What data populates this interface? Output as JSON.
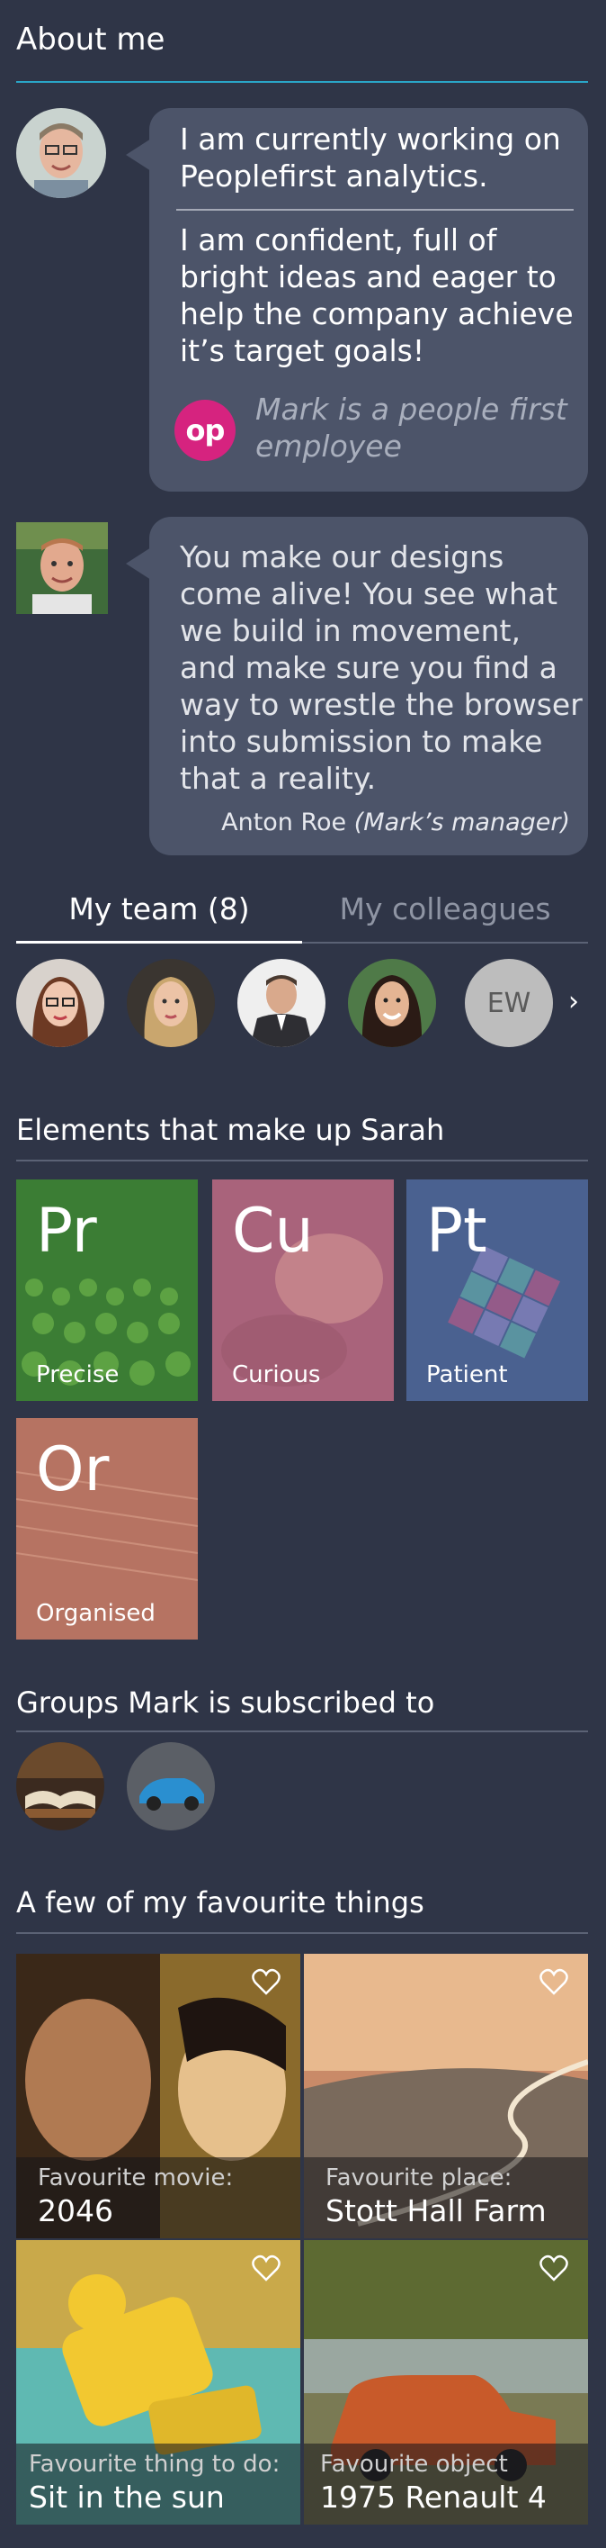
{
  "about": {
    "title": "About me",
    "bubble1": {
      "line1a": "I am currently working on",
      "line1b": "Peoplefirst analytics.",
      "line2a": "I am confident, full of",
      "line2b": "bright ideas and eager to",
      "line2c": "help the company achieve",
      "line2d": "it’s target goals!",
      "logo_text": "op",
      "note_a": "Mark is a people first",
      "note_b": "employee"
    },
    "bubble2": {
      "l1": "You make our designs",
      "l2": "come alive! You see what",
      "l3": "we build in movement,",
      "l4": "and make sure you find a",
      "l5": "way to wrestle the browser",
      "l6": "into submission to make",
      "l7": "that a reality.",
      "author": "Anton Roe ",
      "author_role": "(Mark’s manager)"
    }
  },
  "tabs": {
    "team": "My team (8)",
    "colleagues": "My colleagues",
    "active": "team",
    "initials_avatar": "EW"
  },
  "elements": {
    "title": "Elements that make up Sarah",
    "tiles": [
      {
        "symbol": "Pr",
        "word": "Precise",
        "color": "#3f8a3a"
      },
      {
        "symbol": "Cu",
        "word": "Curious",
        "color": "#b2627f"
      },
      {
        "symbol": "Pt",
        "word": "Patient",
        "color": "#4d6394"
      },
      {
        "symbol": "Or",
        "word": "Organised",
        "color": "#b87461"
      }
    ]
  },
  "groups": {
    "title": "Groups Mark is subscribed to"
  },
  "favourites": {
    "title": "A few of my favourite things",
    "items": [
      {
        "label": "Favourite movie:",
        "value": "2046"
      },
      {
        "label": "Favourite place:",
        "value": "Stott Hall Farm"
      },
      {
        "label": "Favourite thing to do:",
        "value": "Sit in the sun"
      },
      {
        "label": "Favourite object",
        "value": "1975 Renault 4"
      }
    ]
  },
  "colors": {
    "background": "#2f3547",
    "bubble": "#4c5469",
    "accent_teal": "#2aa6c8",
    "peoplefirst_pink": "#d6237f"
  }
}
